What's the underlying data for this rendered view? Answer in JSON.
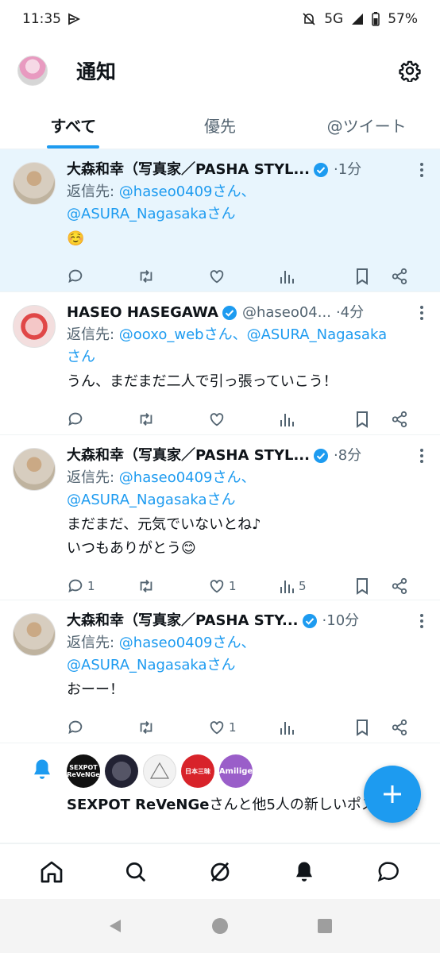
{
  "status_bar": {
    "time": "11:35",
    "network": "5G",
    "battery": "57%"
  },
  "header": {
    "title": "通知"
  },
  "tabs": [
    {
      "label": "すべて",
      "active": true
    },
    {
      "label": "優先",
      "active": false
    },
    {
      "label": "@ツイート",
      "active": false
    }
  ],
  "tweets": [
    {
      "name": "大森和幸（写真家／PASHA STYL...",
      "handle": "",
      "time": "·1分",
      "reply_prefix": "返信先: ",
      "reply_line1": "@haseo0409さん、",
      "reply_line2": "@ASURA_Nagasakaさん",
      "body": "☺️",
      "counts": {
        "reply": "",
        "retweet": "",
        "like": "",
        "views": ""
      }
    },
    {
      "name": "HASEO HASEGAWA",
      "handle": "@haseo04...",
      "time": "·4分",
      "reply_prefix": "返信先: ",
      "reply_line1": "@ooxo_webさん、@ASURA_Nagasaka",
      "reply_line2": "さん",
      "body": "うん、まだまだ二人で引っ張っていこう！",
      "counts": {
        "reply": "",
        "retweet": "",
        "like": "",
        "views": ""
      }
    },
    {
      "name": "大森和幸（写真家／PASHA STYL...",
      "handle": "",
      "time": "·8分",
      "reply_prefix": "返信先: ",
      "reply_line1": "@haseo0409さん、",
      "reply_line2": "@ASURA_Nagasakaさん",
      "body": "まだまだ、元気でいないとね♪\nいつもありがとう😊",
      "counts": {
        "reply": "1",
        "retweet": "",
        "like": "1",
        "views": "5"
      }
    },
    {
      "name": "大森和幸（写真家／PASHA STY...",
      "handle": "",
      "time": "·10分",
      "reply_prefix": "返信先: ",
      "reply_line1": "@haseo0409さん、",
      "reply_line2": "@ASURA_Nagasakaさん",
      "body": "おーー！",
      "counts": {
        "reply": "",
        "retweet": "",
        "like": "1",
        "views": ""
      }
    }
  ],
  "notification": {
    "avatars": [
      "SEXPOT ReVeNGe",
      "",
      "",
      "日本三昧",
      "Amilige"
    ],
    "text_bold": "SEXPOT ReVeNGe",
    "text_rest": "さんと他5人の新しいポスト通知"
  },
  "colors": {
    "accent": "#1d9bf0",
    "text": "#0f1419",
    "muted": "#536471",
    "highlight": "#e8f5fd"
  }
}
